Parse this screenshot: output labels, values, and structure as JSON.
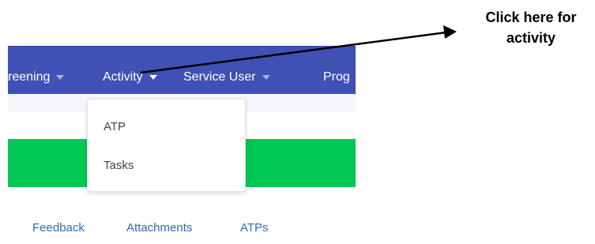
{
  "nav": {
    "items": [
      {
        "label": "reening"
      },
      {
        "label": "Activity"
      },
      {
        "label": "Service User"
      },
      {
        "label": "Prog"
      }
    ]
  },
  "dropdown": {
    "items": [
      {
        "label": "ATP"
      },
      {
        "label": "Tasks"
      }
    ]
  },
  "tabs": [
    {
      "label": "Feedback"
    },
    {
      "label": "Attachments"
    },
    {
      "label": "ATPs"
    }
  ],
  "annotation": {
    "line1": "Click here for",
    "line2": "activity"
  },
  "colors": {
    "nav_bg": "#3f51b5",
    "green_bar": "#00c853",
    "link": "#2f6db5"
  }
}
